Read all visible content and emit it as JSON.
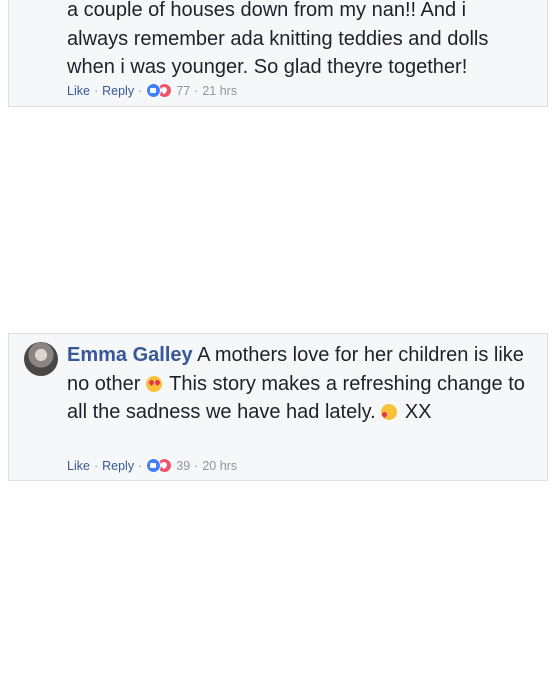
{
  "comments": [
    {
      "author": "",
      "text_lines": [
        "a couple of houses down from my nan!! And i",
        "always remember ada knitting teddies and dolls",
        "when i was younger. So glad theyre together!"
      ],
      "actions": {
        "like_label": "Like",
        "reply_label": "Reply",
        "reaction_count": "77",
        "timestamp": "21 hrs"
      }
    },
    {
      "author": "Emma Galley",
      "text_segments": {
        "part1": "A mothers love for her children is like no other",
        "part2": "This story makes a refreshing change to all the sadness we have had lately.",
        "part3": "XX"
      },
      "emojis": [
        "heart-eyes",
        "kiss"
      ],
      "actions": {
        "like_label": "Like",
        "reply_label": "Reply",
        "reaction_count": "39",
        "timestamp": "20 hrs"
      }
    }
  ],
  "colors": {
    "author_link": "#365899",
    "meta_text": "#90949c",
    "card_bg": "#f6f7f9",
    "card_border": "#dddfe2",
    "like_blue": "#4080ff",
    "love_red": "#f25268"
  },
  "icons": [
    "avatar",
    "like-reaction-icon",
    "love-reaction-icon",
    "heart-eyes-emoji-icon",
    "kiss-emoji-icon"
  ]
}
